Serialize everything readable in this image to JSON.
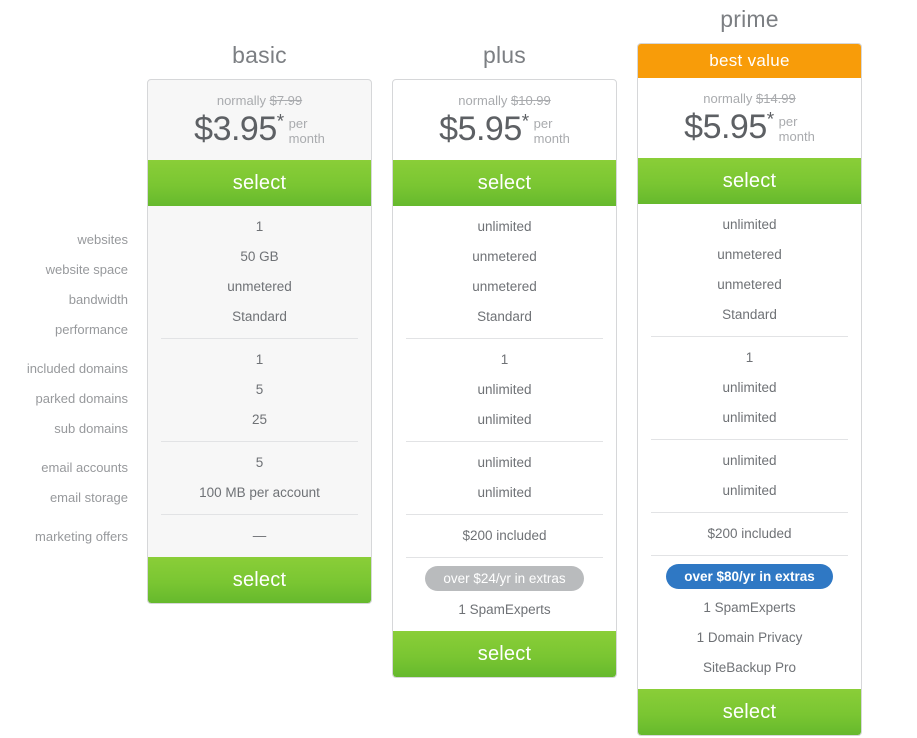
{
  "feature_labels": [
    {
      "label": "websites",
      "group": 1
    },
    {
      "label": "website space",
      "group": 1
    },
    {
      "label": "bandwidth",
      "group": 1
    },
    {
      "label": "performance",
      "group": 1
    },
    {
      "label": "included domains",
      "group": 2
    },
    {
      "label": "parked domains",
      "group": 2
    },
    {
      "label": "sub domains",
      "group": 2
    },
    {
      "label": "email accounts",
      "group": 3
    },
    {
      "label": "email storage",
      "group": 3
    },
    {
      "label": "marketing offers",
      "group": 4
    }
  ],
  "select_label": "select",
  "colors": {
    "green": "#7ac632",
    "orange": "#f89c09",
    "blue_pill": "#2f78c4",
    "gray_pill": "#b9bbbd",
    "card_border": "#d6d7d9",
    "shaded_card": "#f7f7f7",
    "text": "#6f7276",
    "muted_text": "#a9abae"
  },
  "plans": [
    {
      "name": "basic",
      "ribbon": null,
      "normally_prefix": "normally",
      "normally_price": "$7.99",
      "price": "$3.95",
      "asterisk": "*",
      "per": "per",
      "month": "month",
      "features": {
        "websites": "1",
        "website_space": "50 GB",
        "bandwidth": "unmetered",
        "performance": "Standard",
        "included_domains": "1",
        "parked_domains": "5",
        "sub_domains": "25",
        "email_accounts": "5",
        "email_storage": "100 MB per account",
        "marketing_offers": "—"
      },
      "extras_pill": null,
      "extras_items": []
    },
    {
      "name": "plus",
      "ribbon": null,
      "normally_prefix": "normally",
      "normally_price": "$10.99",
      "price": "$5.95",
      "asterisk": "*",
      "per": "per",
      "month": "month",
      "features": {
        "websites": "unlimited",
        "website_space": "unmetered",
        "bandwidth": "unmetered",
        "performance": "Standard",
        "included_domains": "1",
        "parked_domains": "unlimited",
        "sub_domains": "unlimited",
        "email_accounts": "unlimited",
        "email_storage": "unlimited",
        "marketing_offers": "$200 included"
      },
      "extras_pill": "over $24/yr in extras",
      "extras_items": [
        "1 SpamExperts"
      ]
    },
    {
      "name": "prime",
      "ribbon": "best value",
      "normally_prefix": "normally",
      "normally_price": "$14.99",
      "price": "$5.95",
      "asterisk": "*",
      "per": "per",
      "month": "month",
      "features": {
        "websites": "unlimited",
        "website_space": "unmetered",
        "bandwidth": "unmetered",
        "performance": "Standard",
        "included_domains": "1",
        "parked_domains": "unlimited",
        "sub_domains": "unlimited",
        "email_accounts": "unlimited",
        "email_storage": "unlimited",
        "marketing_offers": "$200 included"
      },
      "extras_pill": "over $80/yr in extras",
      "extras_items": [
        "1 SpamExperts",
        "1 Domain Privacy",
        "SiteBackup Pro"
      ]
    }
  ]
}
